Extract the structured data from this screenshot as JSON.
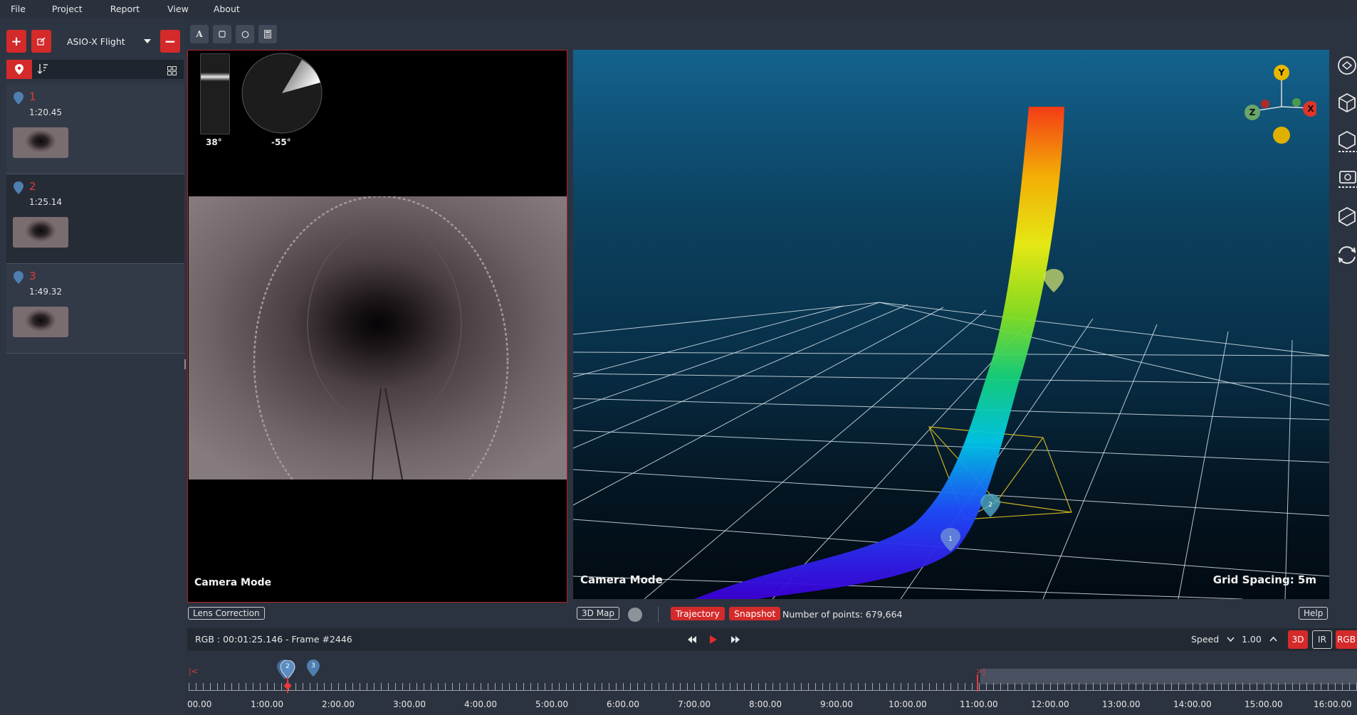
{
  "menu": [
    "File",
    "Project",
    "Report",
    "View",
    "About"
  ],
  "sidebar": {
    "flight_select": "ASIO-X Flight",
    "annotations": [
      {
        "num": "1",
        "time": "1:20.45"
      },
      {
        "num": "2",
        "time": "1:25.14"
      },
      {
        "num": "3",
        "time": "1:49.32"
      }
    ]
  },
  "camera": {
    "tilt_label": "38°",
    "heading_label": "-55°",
    "mode_label": "Camera Mode",
    "lens_correction": "Lens Correction"
  },
  "map": {
    "mode_label": "Camera Mode",
    "grid_label": "Grid Spacing: 5m",
    "axes": {
      "x": "X",
      "y": "Y",
      "z": "Z"
    },
    "btn_3dmap": "3D Map",
    "trajectory": "Trajectory",
    "snapshot": "Snapshot",
    "points": "Number of points: 679,664",
    "help": "Help"
  },
  "playback": {
    "frame_info": "RGB : 00:01:25.146 - Frame #2446",
    "speed_label": "Speed",
    "speed_value": "1.00",
    "mode_3d": "3D",
    "mode_ir": "IR",
    "mode_rgb": "RGB"
  },
  "timeline": {
    "ticks": [
      "00.00",
      "1:00.00",
      "2:00.00",
      "3:00.00",
      "4:00.00",
      "5:00.00",
      "6:00.00",
      "7:00.00",
      "8:00.00",
      "9:00.00",
      "10:00.00",
      "11:00.00",
      "12:00.00",
      "13:00.00",
      "14:00.00",
      "15:00.00",
      "16:00.00"
    ],
    "markers": [
      "2",
      "3"
    ]
  },
  "colors": {
    "accent": "#d42a2a",
    "background": "#2c3340",
    "panel": "#2e3542"
  }
}
